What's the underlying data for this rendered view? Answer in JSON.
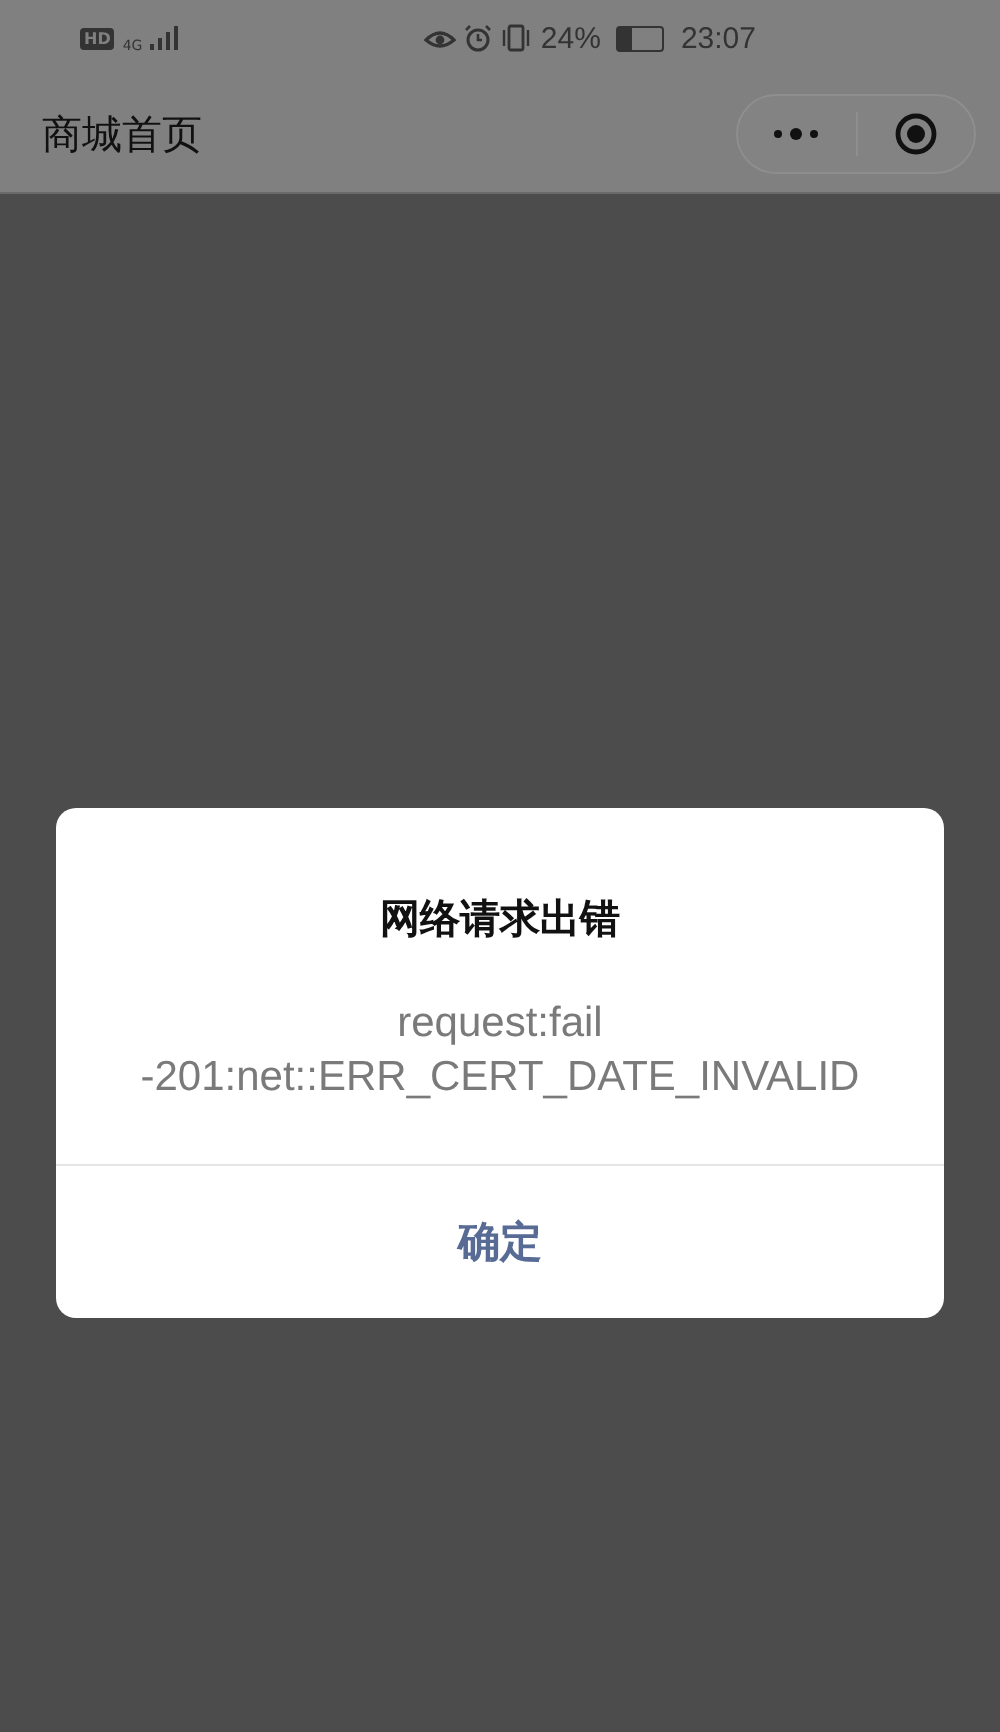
{
  "status_bar": {
    "hd_badge": "HD",
    "network": "4G",
    "battery_percent": "24%",
    "time": "23:07"
  },
  "nav_bar": {
    "title": "商城首页"
  },
  "dialog": {
    "title": "网络请求出错",
    "message": "request:fail -201:net::ERR_CERT_DATE_INVALID",
    "buttons": [
      "确定"
    ]
  }
}
